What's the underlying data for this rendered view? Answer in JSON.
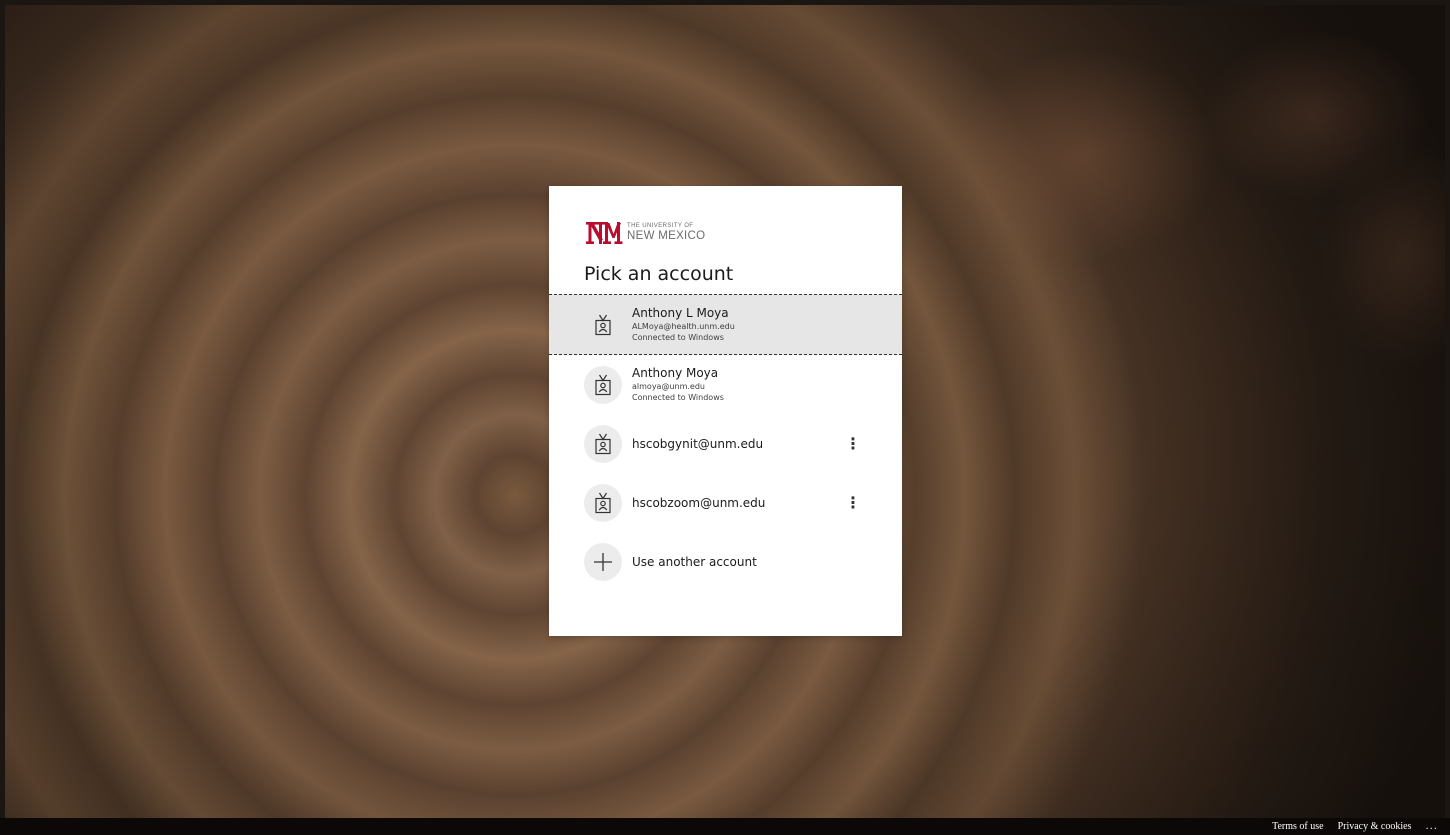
{
  "branding": {
    "logo_small": "THE UNIVERSITY OF",
    "logo_big": "NEW MEXICO",
    "brand_color": "#ba0c2f"
  },
  "title": "Pick an account",
  "accounts": [
    {
      "name": "Anthony L Moya",
      "email": "ALMoya@health.unm.edu",
      "status": "Connected to Windows",
      "selected": true,
      "icon": "badge-icon"
    },
    {
      "name": "Anthony Moya",
      "email": "almoya@unm.edu",
      "status": "Connected to Windows",
      "selected": false,
      "icon": "badge-icon"
    },
    {
      "label": "hscobgynit@unm.edu",
      "icon": "badge-icon",
      "has_menu": true
    },
    {
      "label": "hscobzoom@unm.edu",
      "icon": "badge-icon",
      "has_menu": true
    }
  ],
  "more_options_glyph": "⋮",
  "use_another": {
    "label": "Use another account",
    "icon": "plus-icon"
  },
  "footer": {
    "terms": "Terms of use",
    "privacy": "Privacy & cookies",
    "more": "..."
  }
}
